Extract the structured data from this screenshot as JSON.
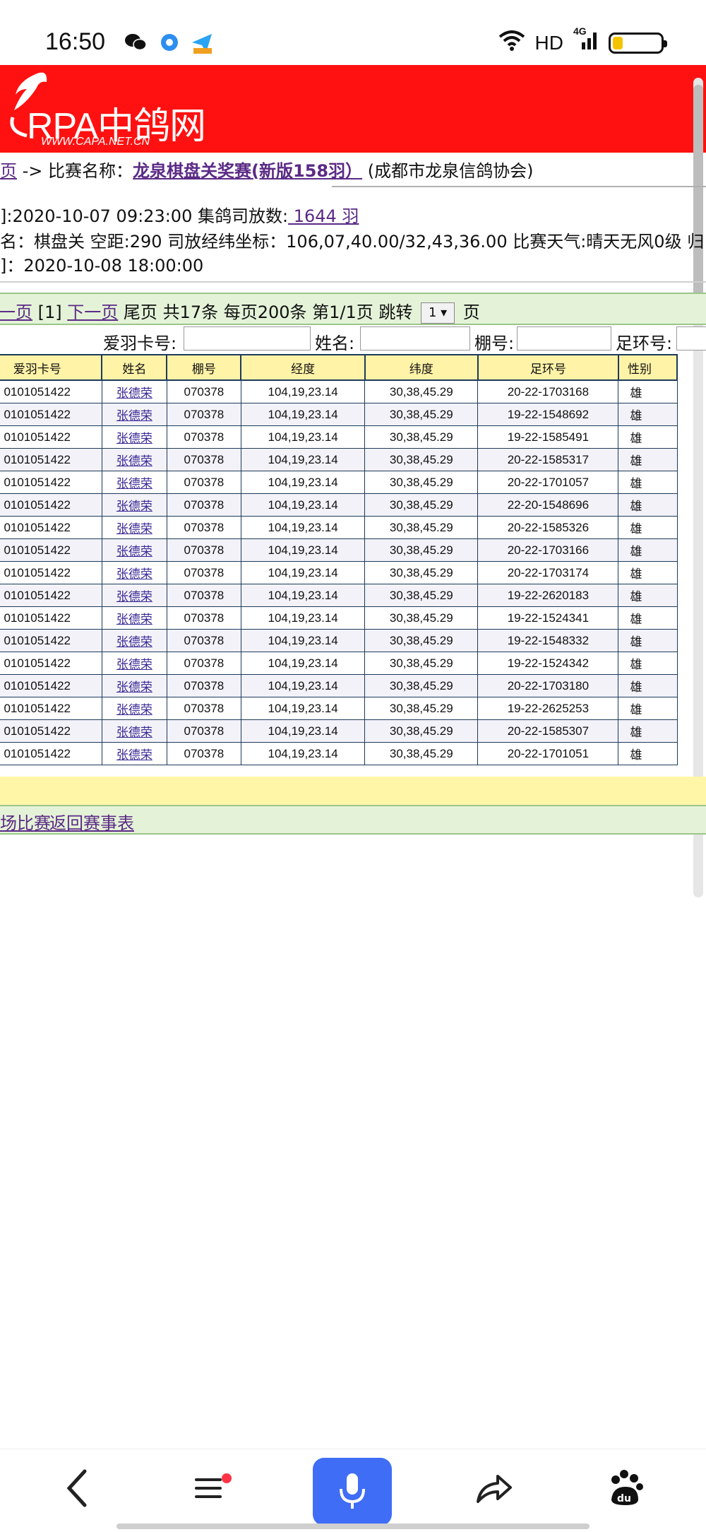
{
  "status": {
    "time": "16:50",
    "network": "HD",
    "signal": "4G"
  },
  "logo": {
    "main": "RPA中鸽网",
    "sub": "WWW.CAPA.NET.CN"
  },
  "info": {
    "crumb_prefix": "页",
    "crumb_arrow": " -> 比赛名称：",
    "race_name": "龙泉棋盘关奖赛(新版158羽）",
    "association": " (成都市龙泉信鸽协会)",
    "line2_prefix": "]:2020-10-07 09:23:00 集鸽司放数:",
    "release_count": " 1644 羽",
    "line3": "名：棋盘关 空距:290 司放经纬坐标：106,07,40.00/32,43,36.00 比赛天气:晴天无风0级 归",
    "line4": "]：2020-10-08 18:00:00"
  },
  "pager": {
    "prev": "一页",
    "current": "[1]",
    "next": "下一页",
    "last": "尾页",
    "summary": "共17条 每页200条 第1/1页 跳转",
    "select_value": "1",
    "suffix": "页"
  },
  "filters": {
    "card_label": "爱羽卡号:",
    "name_label": "姓名:",
    "loft_label": "棚号:",
    "ring_label": "足环号:"
  },
  "table": {
    "headers": [
      "爱羽卡号",
      "姓名",
      "棚号",
      "经度",
      "纬度",
      "足环号",
      "性别"
    ],
    "rows": [
      [
        "0101051422",
        "张德荣",
        "070378",
        "104,19,23.14",
        "30,38,45.29",
        "20-22-1703168",
        "雄"
      ],
      [
        "0101051422",
        "张德荣",
        "070378",
        "104,19,23.14",
        "30,38,45.29",
        "19-22-1548692",
        "雄"
      ],
      [
        "0101051422",
        "张德荣",
        "070378",
        "104,19,23.14",
        "30,38,45.29",
        "19-22-1585491",
        "雄"
      ],
      [
        "0101051422",
        "张德荣",
        "070378",
        "104,19,23.14",
        "30,38,45.29",
        "20-22-1585317",
        "雄"
      ],
      [
        "0101051422",
        "张德荣",
        "070378",
        "104,19,23.14",
        "30,38,45.29",
        "20-22-1701057",
        "雄"
      ],
      [
        "0101051422",
        "张德荣",
        "070378",
        "104,19,23.14",
        "30,38,45.29",
        "22-20-1548696",
        "雄"
      ],
      [
        "0101051422",
        "张德荣",
        "070378",
        "104,19,23.14",
        "30,38,45.29",
        "20-22-1585326",
        "雄"
      ],
      [
        "0101051422",
        "张德荣",
        "070378",
        "104,19,23.14",
        "30,38,45.29",
        "20-22-1703166",
        "雄"
      ],
      [
        "0101051422",
        "张德荣",
        "070378",
        "104,19,23.14",
        "30,38,45.29",
        "20-22-1703174",
        "雄"
      ],
      [
        "0101051422",
        "张德荣",
        "070378",
        "104,19,23.14",
        "30,38,45.29",
        "19-22-2620183",
        "雄"
      ],
      [
        "0101051422",
        "张德荣",
        "070378",
        "104,19,23.14",
        "30,38,45.29",
        "19-22-1524341",
        "雄"
      ],
      [
        "0101051422",
        "张德荣",
        "070378",
        "104,19,23.14",
        "30,38,45.29",
        "19-22-1548332",
        "雄"
      ],
      [
        "0101051422",
        "张德荣",
        "070378",
        "104,19,23.14",
        "30,38,45.29",
        "19-22-1524342",
        "雄"
      ],
      [
        "0101051422",
        "张德荣",
        "070378",
        "104,19,23.14",
        "30,38,45.29",
        "20-22-1703180",
        "雄"
      ],
      [
        "0101051422",
        "张德荣",
        "070378",
        "104,19,23.14",
        "30,38,45.29",
        "19-22-2625253",
        "雄"
      ],
      [
        "0101051422",
        "张德荣",
        "070378",
        "104,19,23.14",
        "30,38,45.29",
        "20-22-1585307",
        "雄"
      ],
      [
        "0101051422",
        "张德荣",
        "070378",
        "104,19,23.14",
        "30,38,45.29",
        "20-22-1701051",
        "雄"
      ]
    ]
  },
  "footer": {
    "other_race": "场比赛",
    "back": "返回赛事表"
  },
  "colors": {
    "header_red": "#ff1111",
    "link_purple": "#5b2a86",
    "mic_blue": "#3f6df5",
    "table_header": "#fff3a8"
  },
  "nav": {
    "back_icon": "chevron-left-icon",
    "menu_icon": "menu-icon",
    "mic_icon": "microphone-icon",
    "share_icon": "share-icon",
    "baidu_icon": "baidu-paw-icon"
  }
}
